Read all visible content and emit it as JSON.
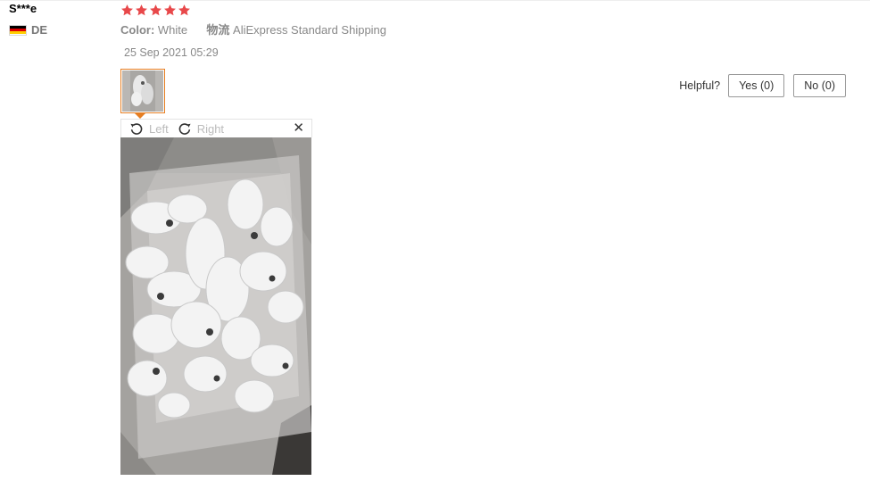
{
  "review": {
    "username": "S***e",
    "country_code": "DE",
    "rating": 5,
    "color_label": "Color:",
    "color_value": "White",
    "shipping_label": "物流",
    "shipping_value": "AliExpress Standard Shipping",
    "date": "25 Sep 2021 05:29",
    "helpful_label": "Helpful?",
    "yes_label": "Yes (0)",
    "no_label": "No (0)"
  },
  "viewer": {
    "rotate_left_label": "Left",
    "rotate_right_label": "Right",
    "close_glyph": "✕"
  },
  "icons": {
    "star": "star-icon",
    "flag": "germany-flag-icon",
    "rotate_left": "rotate-left-icon",
    "rotate_right": "rotate-right-icon",
    "close": "close-icon"
  },
  "colors": {
    "star": "#e8484a",
    "thumb_border": "#e67e22",
    "flag_black": "#000000",
    "flag_red": "#dd0000",
    "flag_gold": "#ffce00"
  }
}
